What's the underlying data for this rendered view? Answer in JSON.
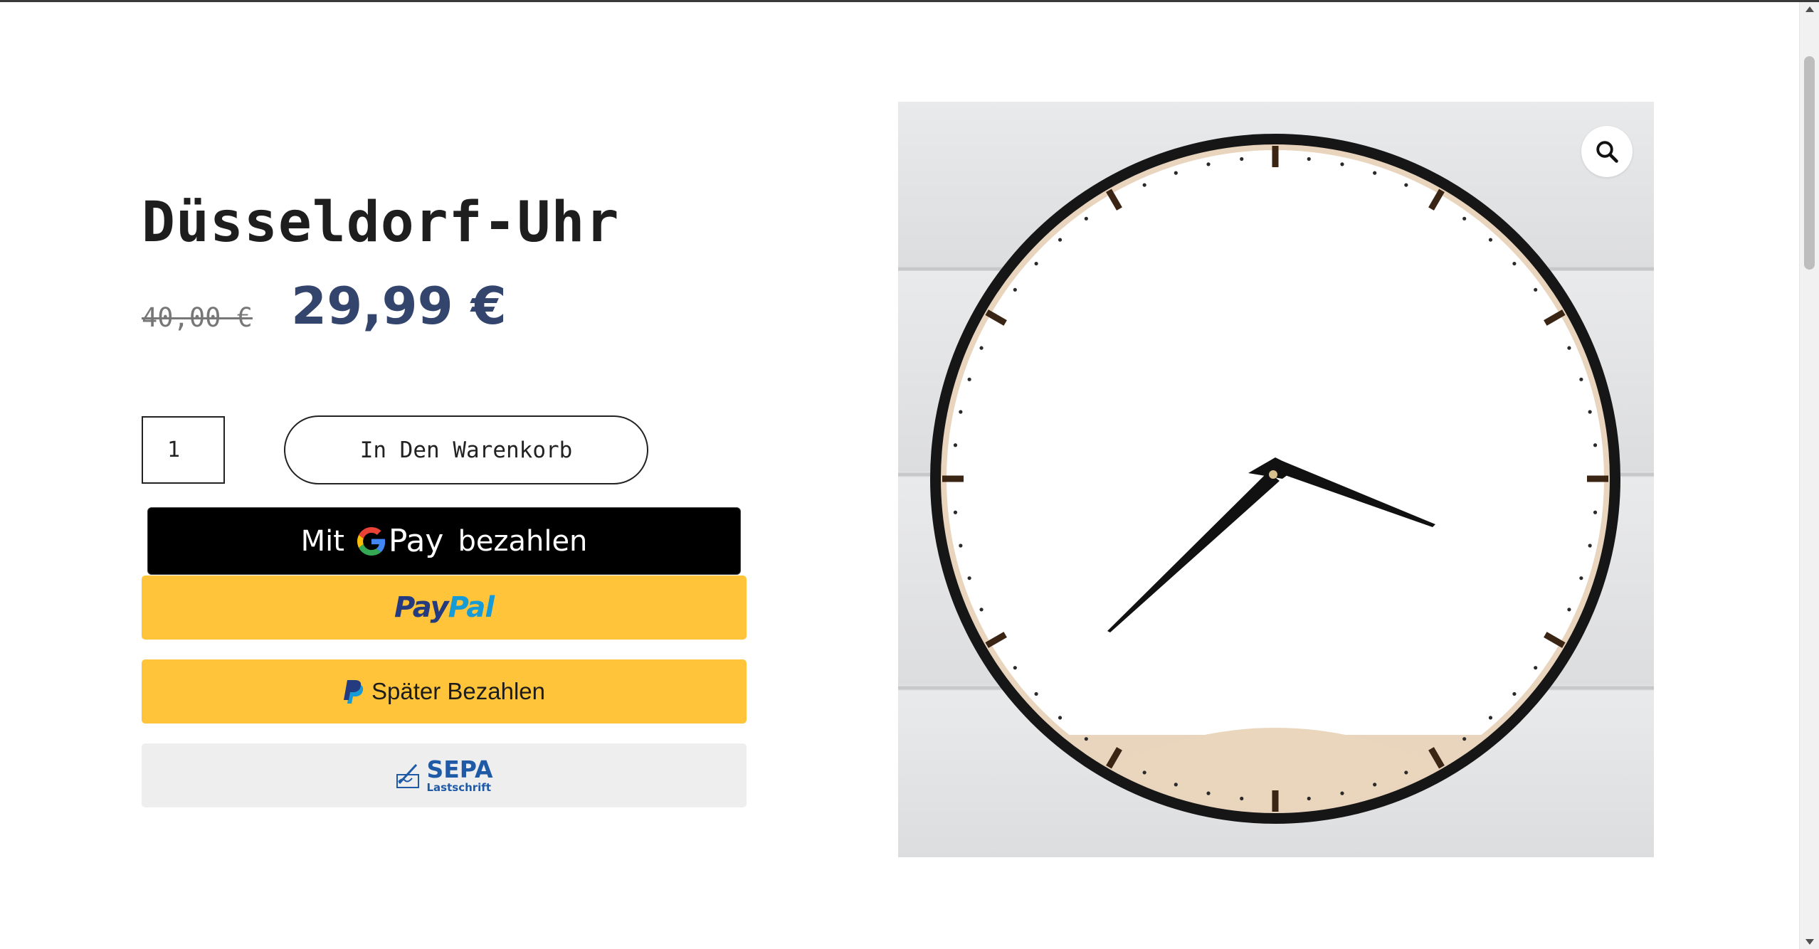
{
  "product": {
    "title": "Düsseldorf-Uhr",
    "price_old": "40,00 €",
    "price_new": "29,99 €",
    "quantity": "1",
    "image_alt": "Düsseldorf-Uhr"
  },
  "actions": {
    "add_to_cart": "In Den Warenkorb",
    "gpay": {
      "prefix": "Mit",
      "brand": "Pay",
      "suffix": "bezahlen"
    },
    "paypal": {
      "part1": "Pay",
      "part2": "Pal"
    },
    "paylater": "Später Bezahlen",
    "sepa": {
      "main": "SEPA",
      "sub": "Lastschrift"
    }
  },
  "icons": {
    "zoom": "magnifier-icon",
    "paypal_mark": "paypal-p-icon",
    "google_g": "google-g-icon",
    "sepa_mark": "sepa-signature-icon"
  },
  "colors": {
    "price_new": "#33456d",
    "price_old": "#777777",
    "paypal_yellow": "#ffc439",
    "paypal_dark": "#253b80",
    "paypal_light": "#179bd7",
    "sepa_blue": "#1f5aa6",
    "gpay_black": "#000000"
  }
}
